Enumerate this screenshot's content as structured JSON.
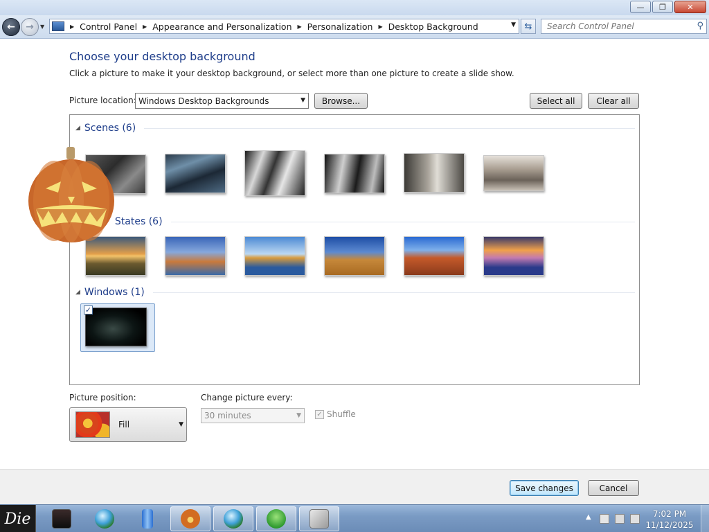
{
  "window": {
    "minimize": "—",
    "maximize": "❐",
    "close": "✕"
  },
  "nav": {
    "breadcrumbs": [
      "Control Panel",
      "Appearance and Personalization",
      "Personalization",
      "Desktop Background"
    ],
    "search_placeholder": "Search Control Panel"
  },
  "page": {
    "title": "Choose your desktop background",
    "subtitle": "Click a picture to make it your desktop background, or select more than one picture to create a slide show.",
    "picture_location_label": "Picture location:",
    "picture_location_value": "Windows Desktop Backgrounds",
    "browse_label": "Browse...",
    "select_all_label": "Select all",
    "clear_all_label": "Clear all"
  },
  "groups": [
    {
      "title": "Scenes (6)",
      "count": 6
    },
    {
      "title": "States (6)",
      "count": 6
    },
    {
      "title": "Windows (1)",
      "count": 1
    }
  ],
  "selected_tile": {
    "checked": true
  },
  "picture_position": {
    "label": "Picture position:",
    "value": "Fill"
  },
  "change_picture": {
    "label": "Change picture every:",
    "value": "30 minutes",
    "shuffle_label": "Shuffle",
    "shuffle_checked": true
  },
  "footer": {
    "save_label": "Save changes",
    "cancel_label": "Cancel"
  },
  "taskbar": {
    "start_text": "Die",
    "time": "7:02 PM",
    "date": "11/12/2025"
  },
  "colors": {
    "heading": "#1e3d8a",
    "taskbar": "#7a9bc4"
  }
}
